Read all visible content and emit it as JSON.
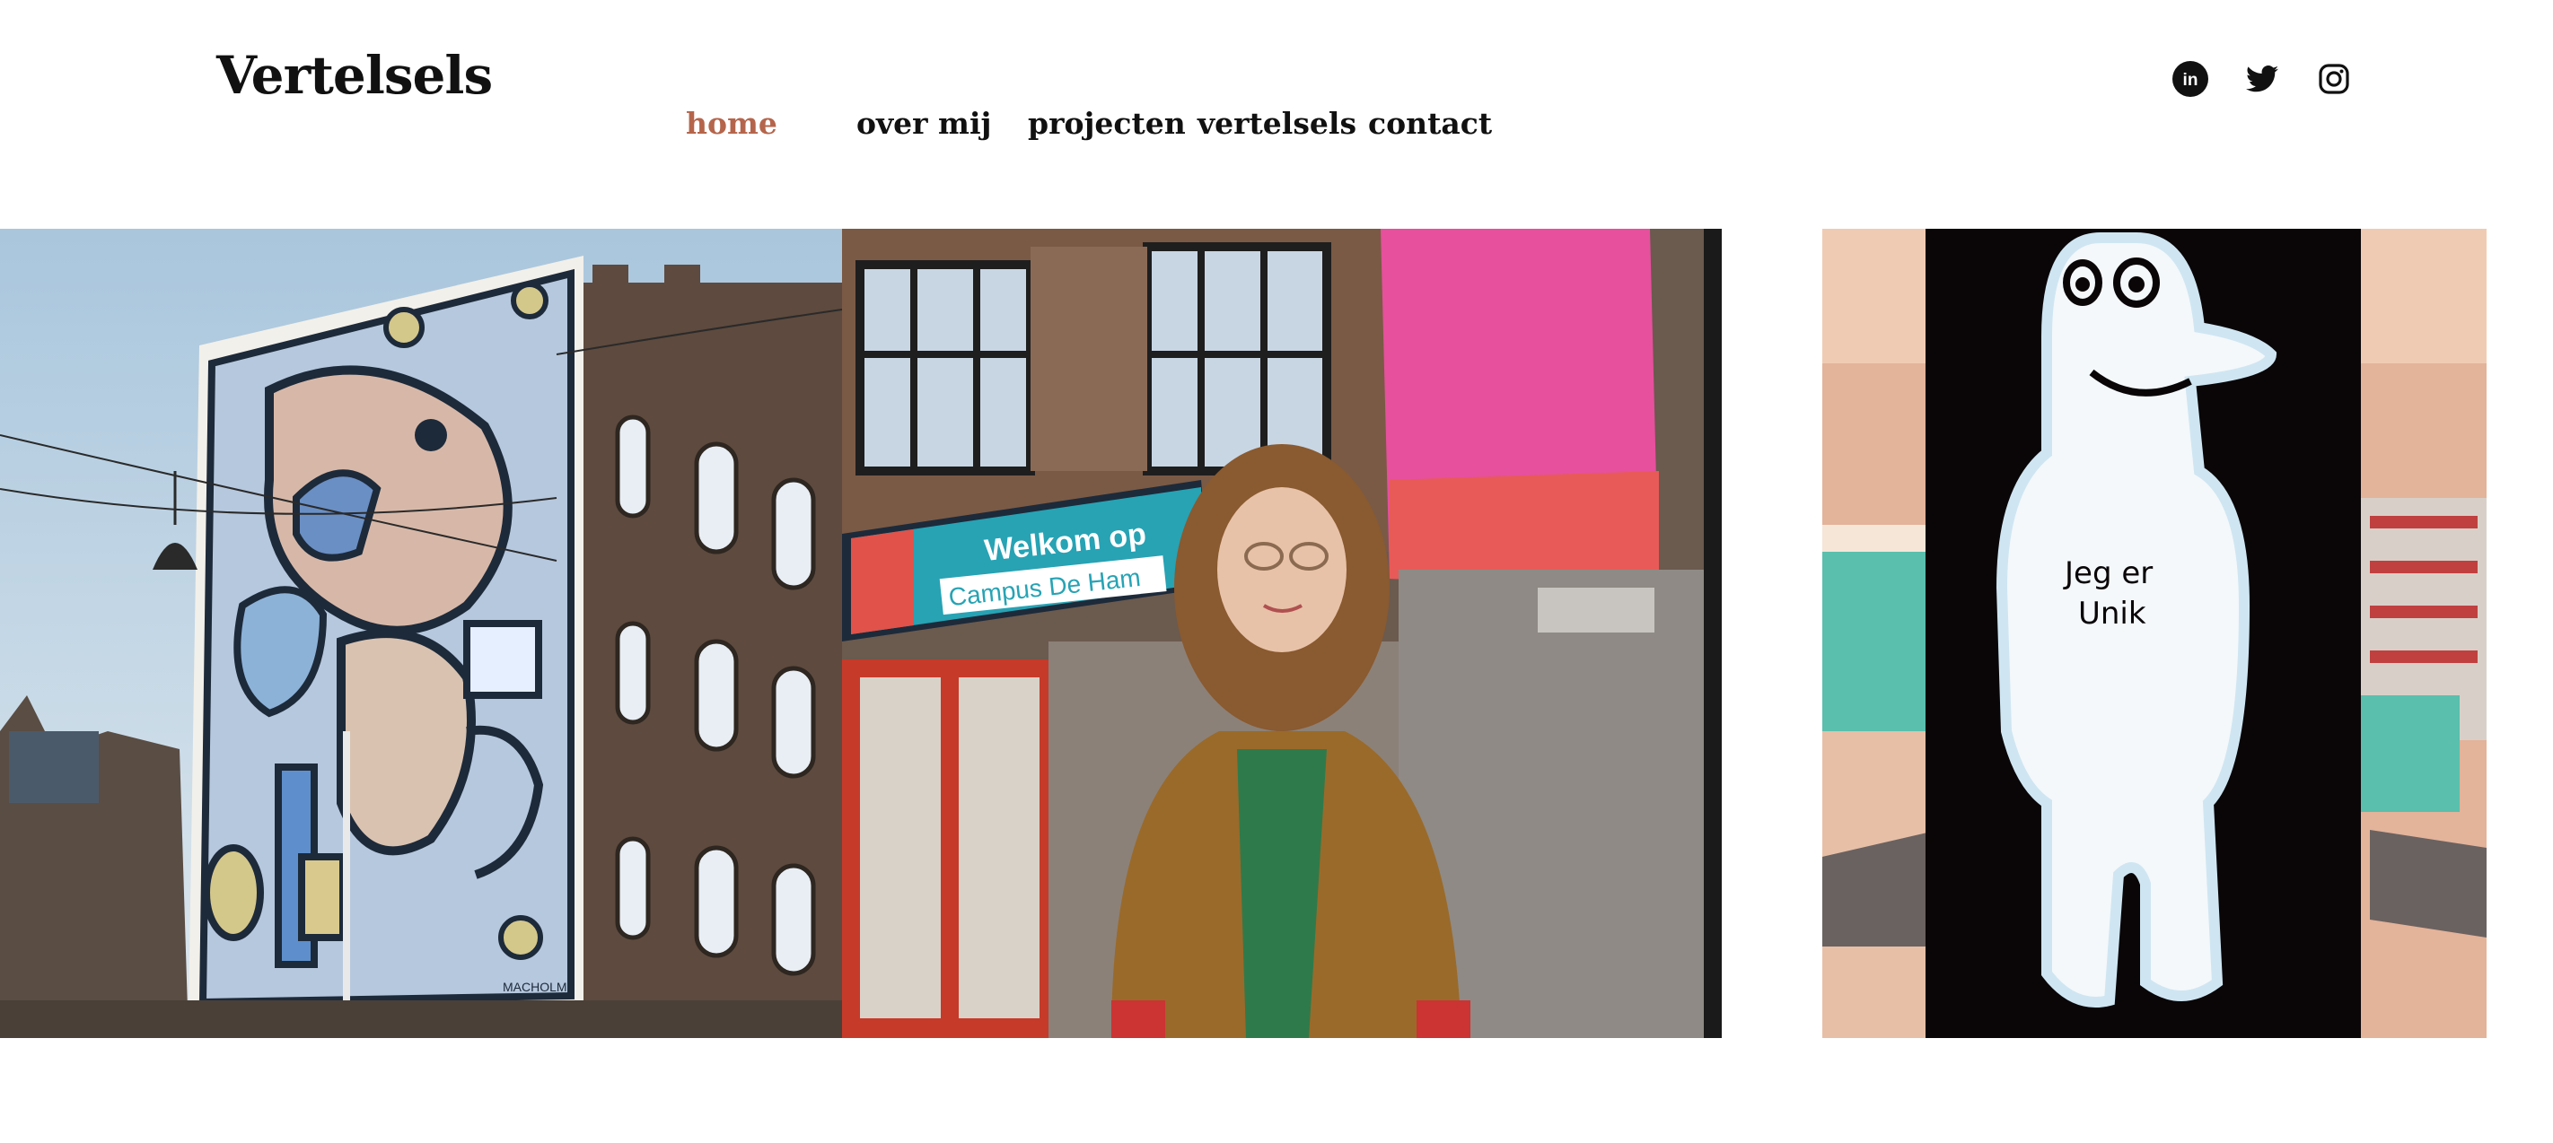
{
  "site": {
    "title": "Vertelsels"
  },
  "nav": {
    "items": [
      {
        "label": "home",
        "active": true
      },
      {
        "label": "over mij",
        "active": false
      },
      {
        "label": "projecten",
        "active": false
      },
      {
        "label": "vertelsels",
        "active": false
      },
      {
        "label": "contact",
        "active": false
      }
    ],
    "active_color": "#b5654b"
  },
  "social": [
    {
      "name": "linkedin-icon",
      "label": "in"
    },
    {
      "name": "twitter-icon"
    },
    {
      "name": "instagram-icon"
    }
  ],
  "gallery": {
    "photo_1": {
      "subject": "mural-building",
      "signature": "MACHOLM"
    },
    "photo_2": {
      "subject": "woman-campus",
      "sign_line_1": "Welkom op",
      "sign_line_2": "Campus De Ham"
    },
    "photo_3": {
      "subject": "lightbox-figure",
      "sign_text_1": "Jeg er",
      "sign_text_2": "Unik"
    }
  }
}
